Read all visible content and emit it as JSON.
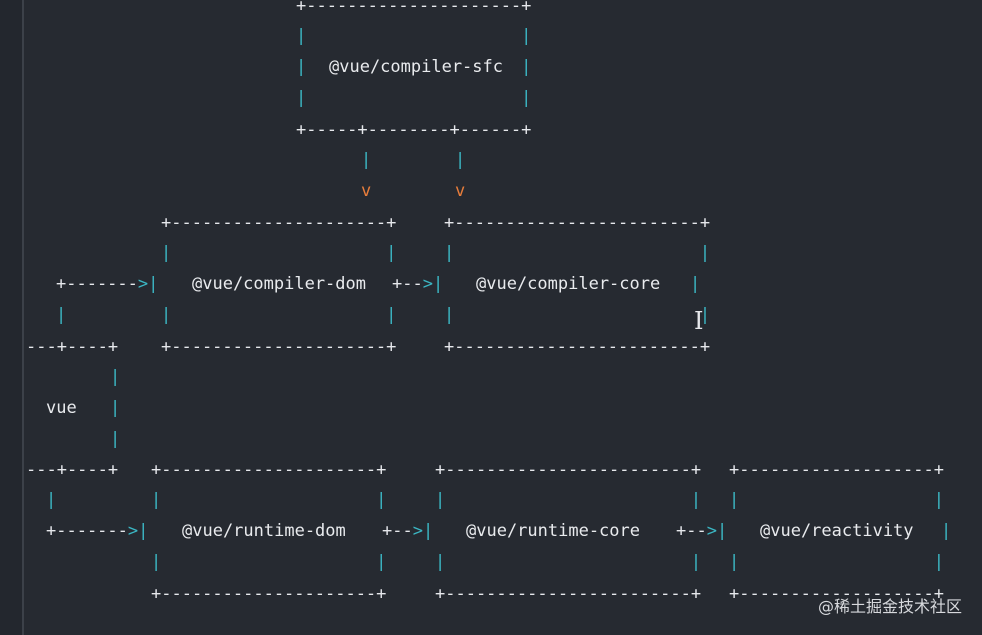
{
  "diagram": {
    "boxes": {
      "compiler_sfc": "@vue/compiler-sfc",
      "compiler_dom": "@vue/compiler-dom",
      "compiler_core": "@vue/compiler-core",
      "vue": "vue",
      "runtime_dom": "@vue/runtime-dom",
      "runtime_core": "@vue/runtime-core",
      "reactivity": "@vue/reactivity"
    },
    "arrow_head_down": "v"
  },
  "watermark": "@稀土掘金技术社区",
  "colors": {
    "background": "#262a31",
    "border_plus": "#e6e8ec",
    "border_line": "#3bb7c4",
    "arrow_head": "#e77d3b"
  }
}
